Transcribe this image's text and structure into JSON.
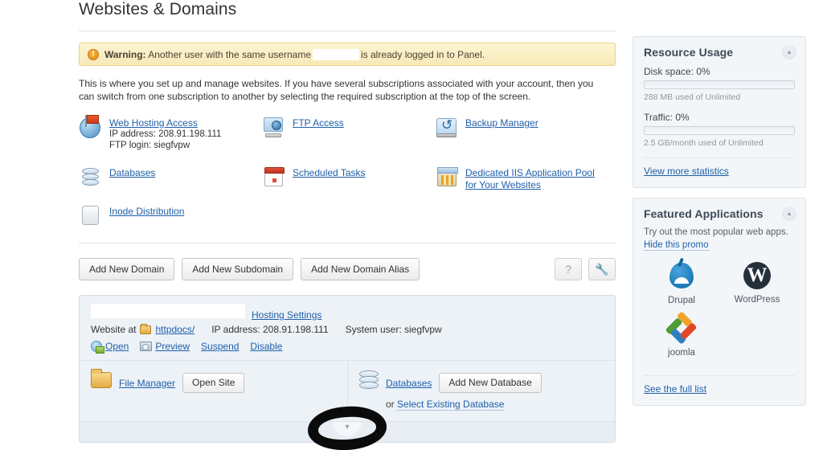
{
  "page": {
    "title": "Websites & Domains"
  },
  "warning": {
    "icon": "warning-exclamation-icon",
    "label": "Warning:",
    "text_before": "Another user with the same username",
    "text_after": "is already logged in to Panel."
  },
  "intro": {
    "text": "This is where you set up and manage websites. If you have several subscriptions associated with your account, then you can switch from one subscription to another by selecting the required subscription at the top of the screen."
  },
  "shortcuts": [
    {
      "id": "web-hosting-access",
      "icon": "globe-flag-icon",
      "label": "Web Hosting Access",
      "sub1": "IP address: 208.91.198.111",
      "sub2": "FTP login: siegfvpw"
    },
    {
      "id": "ftp-access",
      "icon": "ftp-server-icon",
      "label": "FTP Access"
    },
    {
      "id": "backup-manager",
      "icon": "backup-drive-icon",
      "label": "Backup Manager"
    },
    {
      "id": "databases",
      "icon": "database-icon",
      "label": "Databases"
    },
    {
      "id": "scheduled-tasks",
      "icon": "calendar-icon",
      "label": "Scheduled Tasks"
    },
    {
      "id": "dedicated-iis-pool",
      "icon": "iis-pool-icon",
      "label_line1": "Dedicated IIS Application Pool",
      "label_line2": "for Your Websites"
    },
    {
      "id": "inode-distribution",
      "icon": "document-icon",
      "label": "Inode Distribution"
    }
  ],
  "toolbar": {
    "add_new_domain": "Add New Domain",
    "add_new_subdomain": "Add New Subdomain",
    "add_new_domain_alias": "Add New Domain Alias",
    "help_icon": "question-mark-icon",
    "settings_icon": "wrench-icon"
  },
  "domain": {
    "name_redacted": "",
    "hosting_settings": "Hosting Settings",
    "website_at_label": "Website at",
    "docroot": "httpdocs/",
    "ip_address": "IP address: 208.91.198.111",
    "system_user": "System user: siegfvpw",
    "actions": {
      "open": "Open",
      "preview": "Preview",
      "suspend": "Suspend",
      "disable": "Disable"
    },
    "tools": {
      "file_manager": "File Manager",
      "open_site": "Open Site",
      "databases": "Databases",
      "add_new_database": "Add New Database",
      "or_label": "or",
      "select_existing_database": "Select Existing Database"
    },
    "expander_icon": "chevron-down-icon"
  },
  "annotation": {
    "shape": "hand-drawn-circle",
    "color": "#0b0b0b"
  },
  "resource_usage": {
    "title": "Resource Usage",
    "collapse_icon": "chevron-up-icon",
    "metrics": [
      {
        "label": "Disk space: 0%",
        "percent": 0,
        "note": "288 MB used of Unlimited"
      },
      {
        "label": "Traffic: 0%",
        "percent": 0,
        "note": "2.5 GB/month used of Unlimited"
      }
    ],
    "view_more": "View more statistics"
  },
  "featured_applications": {
    "title": "Featured Applications",
    "collapse_icon": "chevron-up-icon",
    "promo_text": "Try out the most popular web apps.",
    "hide_promo": "Hide this promo",
    "apps": [
      {
        "id": "drupal",
        "name": "Drupal",
        "icon": "drupal-logo"
      },
      {
        "id": "wordpress",
        "name": "WordPress",
        "icon": "wordpress-logo",
        "glyph": "W"
      },
      {
        "id": "joomla",
        "name": "joomla",
        "icon": "joomla-logo"
      }
    ],
    "see_full_list": "See the full list"
  },
  "colors": {
    "link": "#1f5fa9",
    "warning_bg": "#fdf4d2",
    "warning_border": "#e8d28b",
    "panel_bg": "#f3f6f9",
    "domain_panel_bg": "#edf2f7"
  }
}
